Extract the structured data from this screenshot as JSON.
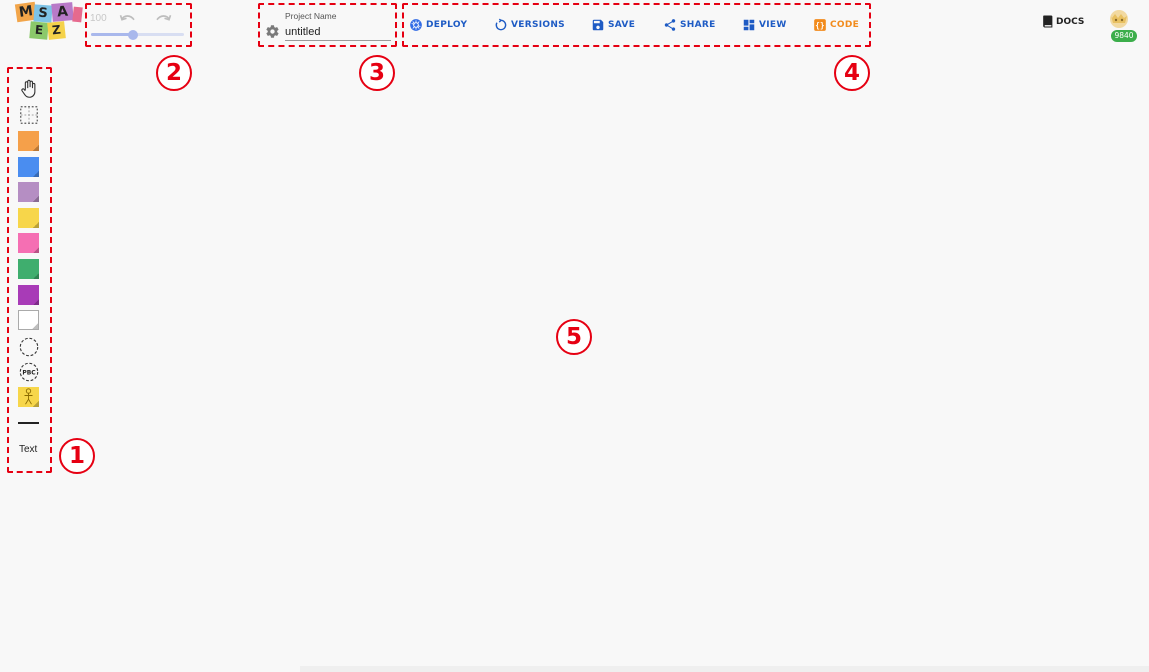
{
  "logo": {
    "letters": [
      "M",
      "S",
      "A",
      "E",
      "Z"
    ],
    "name": "msa-ez-logo"
  },
  "zoom": {
    "value": "100",
    "level": 0.45
  },
  "history": {
    "undo_icon": "undo-icon",
    "redo_icon": "redo-icon"
  },
  "project": {
    "label": "Project Name",
    "value": "untitled",
    "icon": "gear-icon"
  },
  "toolbar": {
    "deploy": "DEPLOY",
    "versions": "VERSIONS",
    "save": "SAVE",
    "share": "SHARE",
    "view": "VIEW",
    "code": "CODE"
  },
  "docs": {
    "label": "DOCS"
  },
  "user": {
    "coins": "9840"
  },
  "palette": {
    "items": [
      {
        "name": "hand-tool-icon"
      },
      {
        "name": "marquee-select-icon"
      },
      {
        "name": "event-sticky",
        "color": "#f5a04a"
      },
      {
        "name": "command-sticky",
        "color": "#4a8df0"
      },
      {
        "name": "policy-sticky",
        "color": "#b58ec3"
      },
      {
        "name": "aggregate-sticky",
        "color": "#f7d64a"
      },
      {
        "name": "external-sticky",
        "color": "#f56fb3"
      },
      {
        "name": "view-sticky",
        "color": "#3fae6e"
      },
      {
        "name": "issue-sticky",
        "color": "#a83bb7"
      },
      {
        "name": "blank-sticky",
        "color": "#ffffff"
      },
      {
        "name": "bounded-context-icon"
      },
      {
        "name": "pbc-icon",
        "label": "PBC"
      },
      {
        "name": "actor-sticky",
        "color": "#f7d64a"
      },
      {
        "name": "line-tool"
      }
    ],
    "text_label": "Text"
  },
  "callouts": [
    "1",
    "2",
    "3",
    "4",
    "5"
  ],
  "colors": {
    "accent_red": "#e60012",
    "primary_blue": "#1e5bc4",
    "code_orange": "#f28b1c",
    "coin_green": "#3cae4b"
  }
}
